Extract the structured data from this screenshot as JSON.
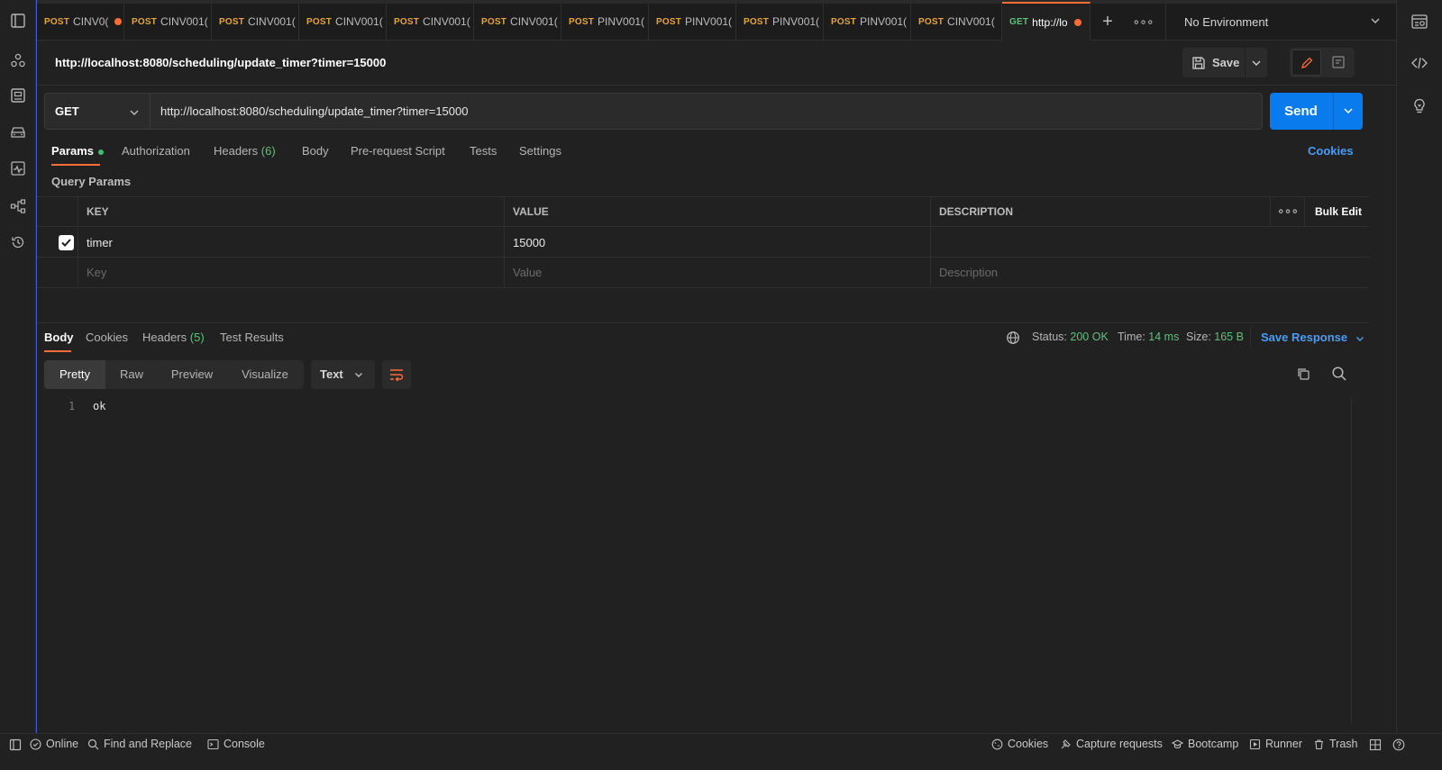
{
  "tabs": [
    {
      "method": "POST",
      "name": "CINV0(",
      "dot": true
    },
    {
      "method": "POST",
      "name": "CINV001(",
      "dot": false
    },
    {
      "method": "POST",
      "name": "CINV001(",
      "dot": false
    },
    {
      "method": "POST",
      "name": "CINV001(",
      "dot": false
    },
    {
      "method": "POST",
      "name": "CINV001(",
      "dot": false
    },
    {
      "method": "POST",
      "name": "CINV001(",
      "dot": false
    },
    {
      "method": "POST",
      "name": "PINV001(",
      "dot": false
    },
    {
      "method": "POST",
      "name": "PINV001(",
      "dot": false
    },
    {
      "method": "POST",
      "name": "PINV001(",
      "dot": false
    },
    {
      "method": "POST",
      "name": "PINV001(",
      "dot": false
    },
    {
      "method": "POST",
      "name": "CINV001(",
      "dot": false
    },
    {
      "method": "GET",
      "name": "http://lo",
      "dot": true,
      "active": true
    }
  ],
  "environment": "No Environment",
  "request": {
    "title": "http://localhost:8080/scheduling/update_timer?timer=15000",
    "save_label": "Save",
    "method": "GET",
    "url": "http://localhost:8080/scheduling/update_timer?timer=15000",
    "send_label": "Send"
  },
  "request_tabs": {
    "params": "Params",
    "authorization": "Authorization",
    "headers": "Headers",
    "headers_count": "(6)",
    "body": "Body",
    "prerequest": "Pre-request Script",
    "tests": "Tests",
    "settings": "Settings",
    "cookies": "Cookies"
  },
  "query_params": {
    "title": "Query Params",
    "columns": [
      "KEY",
      "VALUE",
      "DESCRIPTION"
    ],
    "bulk_edit": "Bulk Edit",
    "row": {
      "key": "timer",
      "value": "15000",
      "description": "",
      "checked": true
    },
    "placeholders": {
      "key": "Key",
      "value": "Value",
      "description": "Description"
    }
  },
  "response": {
    "tabs": {
      "body": "Body",
      "cookies": "Cookies",
      "headers": "Headers",
      "headers_count": "(5)",
      "tests": "Test Results"
    },
    "status_label": "Status:",
    "status_value": "200 OK",
    "time_label": "Time:",
    "time_value": "14 ms",
    "size_label": "Size:",
    "size_value": "165 B",
    "save_response": "Save Response",
    "formats": [
      "Pretty",
      "Raw",
      "Preview",
      "Visualize"
    ],
    "type": "Text",
    "line_number": "1",
    "body_text": "ok"
  },
  "statusbar": {
    "online": "Online",
    "find_replace": "Find and Replace",
    "console": "Console",
    "cookies": "Cookies",
    "capture": "Capture requests",
    "bootcamp": "Bootcamp",
    "runner": "Runner",
    "trash": "Trash"
  },
  "colors": {
    "accent": "#ff6c37",
    "send": "#097bed",
    "link": "#4b9cf5",
    "success": "#5ec17a",
    "post": "#e7a43a"
  }
}
